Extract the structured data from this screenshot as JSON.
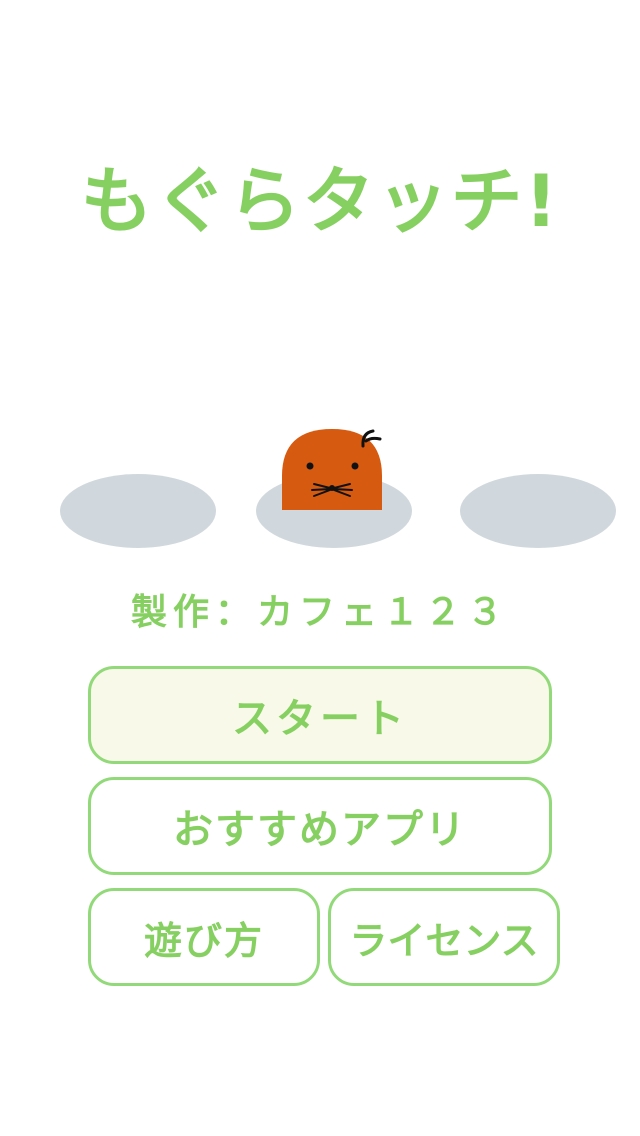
{
  "title": "もぐらタッチ!",
  "credit": "製作：カフェ１２３",
  "buttons": {
    "start": "スタート",
    "recommended_apps": "おすすめアプリ",
    "how_to_play": "遊び方",
    "license": "ライセンス"
  },
  "colors": {
    "accent_green": "#86d062",
    "button_border": "#92d97a",
    "start_button_bg": "#f8f9e8",
    "hole": "#d1d8dd",
    "mole": "#d65a0f"
  },
  "icons": [
    "mole-icon"
  ]
}
